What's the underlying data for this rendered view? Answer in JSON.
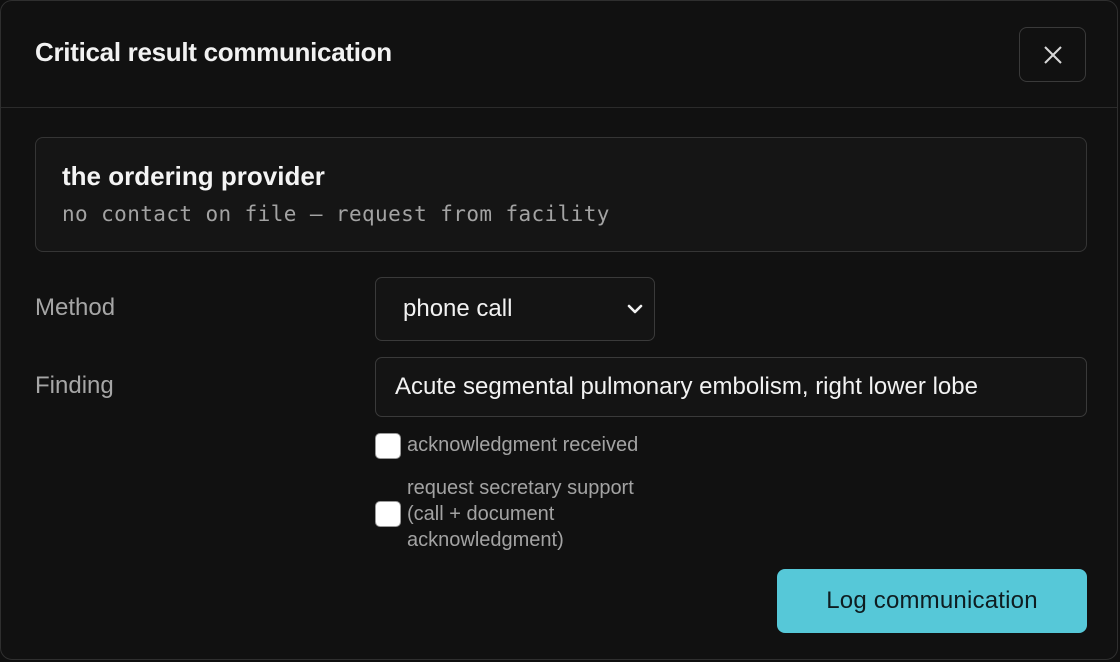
{
  "dialog": {
    "title": "Critical result communication",
    "close_icon": "close-icon"
  },
  "contact": {
    "name": "the ordering provider",
    "note": "no contact on file — request from facility"
  },
  "form": {
    "method_label": "Method",
    "method_value": "phone call",
    "finding_label": "Finding",
    "finding_value": "Acute segmental pulmonary embolism, right lower lobe"
  },
  "checkboxes": [
    {
      "label": "acknowledgment received",
      "checked": false
    },
    {
      "label_lines": [
        "request secretary support",
        "(call + document",
        "acknowledgment)"
      ],
      "checked": false
    }
  ],
  "actions": {
    "submit_label": "Log communication"
  },
  "colors": {
    "accent": "#56c8d8",
    "background": "#111111",
    "border": "#3a3a3a"
  }
}
